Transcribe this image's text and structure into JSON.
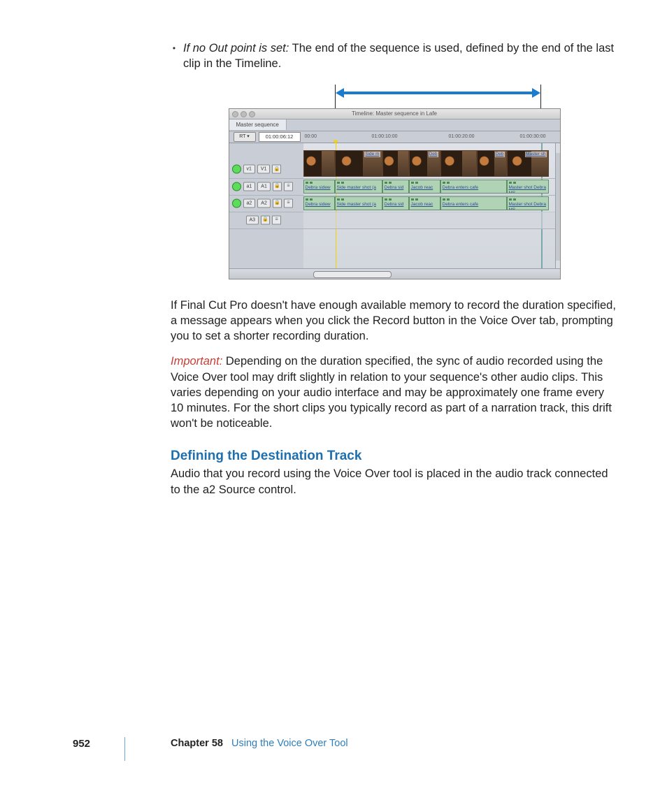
{
  "bullet": {
    "label": "If no Out point is set:",
    "rest": "  The end of the sequence is used, defined by the end of the last clip in the Timeline."
  },
  "screenshot": {
    "titlebar": "Timeline: Master sequence in Lafe",
    "tab": "Master sequence",
    "rt_button": "RT ▾",
    "timecode": "01:00:06:12",
    "ruler_ticks": [
      "00:00",
      "01:00:10:00",
      "01:00:20:00",
      "01:00:30:00"
    ],
    "tracks": {
      "v1_src": "v1",
      "v1_dst": "V1",
      "a1_src": "a1",
      "a1_dst": "A1",
      "a2_src": "a2",
      "a2_dst": "A2",
      "a3_dst": "A3"
    },
    "video_clips": [
      {
        "label": ""
      },
      {
        "label": "Side m"
      },
      {
        "label": ""
      },
      {
        "label": "Deb"
      },
      {
        "label": ""
      },
      {
        "label": "Deb"
      },
      {
        "label": "Master sh"
      }
    ],
    "audio_clips_row": [
      "Debra sidew",
      "Side master shot (a",
      "Debra sid",
      "Jacob reac",
      "Debra enters cafe",
      "Master shot Debra MS"
    ]
  },
  "para_memory": "If Final Cut Pro doesn't have enough available memory to record the duration specified, a message appears when you click the Record button in the Voice Over tab, prompting you to set a shorter recording duration.",
  "important": {
    "label": "Important:",
    "body": "  Depending on the duration specified, the sync of audio recorded using the Voice Over tool may drift slightly in relation to your sequence's other audio clips. This varies depending on your audio interface and may be approximately one frame every 10 minutes. For the short clips you typically record as part of a narration track, this drift won't be noticeable."
  },
  "section": {
    "heading": "Defining the Destination Track",
    "body": "Audio that you record using the Voice Over tool is placed in the audio track connected to the a2 Source control."
  },
  "footer": {
    "page": "952",
    "chapter": "Chapter 58",
    "title": "Using the Voice Over Tool"
  }
}
